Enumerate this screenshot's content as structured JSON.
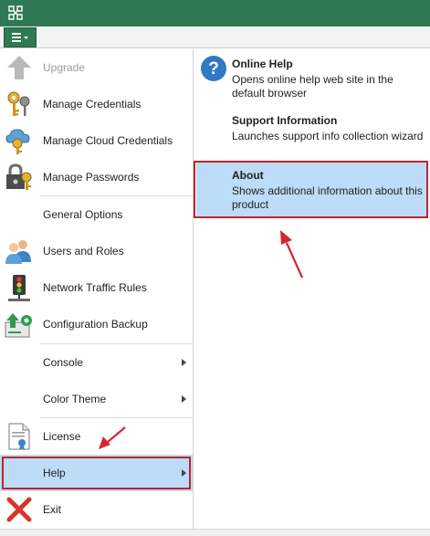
{
  "app_menu": {
    "items": [
      {
        "label": "Upgrade",
        "icon": "upgrade-arrow-icon",
        "disabled": true
      },
      {
        "label": "Manage Credentials",
        "icon": "keys-icon"
      },
      {
        "label": "Manage Cloud Credentials",
        "icon": "cloud-key-icon"
      },
      {
        "label": "Manage Passwords",
        "icon": "lock-key-icon"
      },
      {
        "label": "General Options"
      },
      {
        "label": "Users and Roles",
        "icon": "users-icon"
      },
      {
        "label": "Network Traffic Rules",
        "icon": "traffic-light-icon"
      },
      {
        "label": "Configuration Backup",
        "icon": "config-backup-icon"
      },
      {
        "label": "Console",
        "has_submenu": true
      },
      {
        "label": "Color Theme",
        "has_submenu": true
      },
      {
        "label": "License",
        "icon": "license-icon"
      },
      {
        "label": "Help",
        "has_submenu": true,
        "selected": true
      },
      {
        "label": "Exit",
        "icon": "exit-x-icon"
      }
    ]
  },
  "help_submenu": {
    "items": [
      {
        "title": "Online Help",
        "description": "Opens online help web site in the default browser",
        "icon": "help-question-icon"
      },
      {
        "title": "Support Information",
        "description": "Launches support info collection wizard"
      },
      {
        "title": "About",
        "description": "Shows additional information about this product",
        "selected": true
      }
    ]
  },
  "colors": {
    "titlebar": "#2f7a54",
    "selection": "#bcdcf7",
    "highlight_border": "#c4232b",
    "annotation_arrow": "#d7262e"
  }
}
